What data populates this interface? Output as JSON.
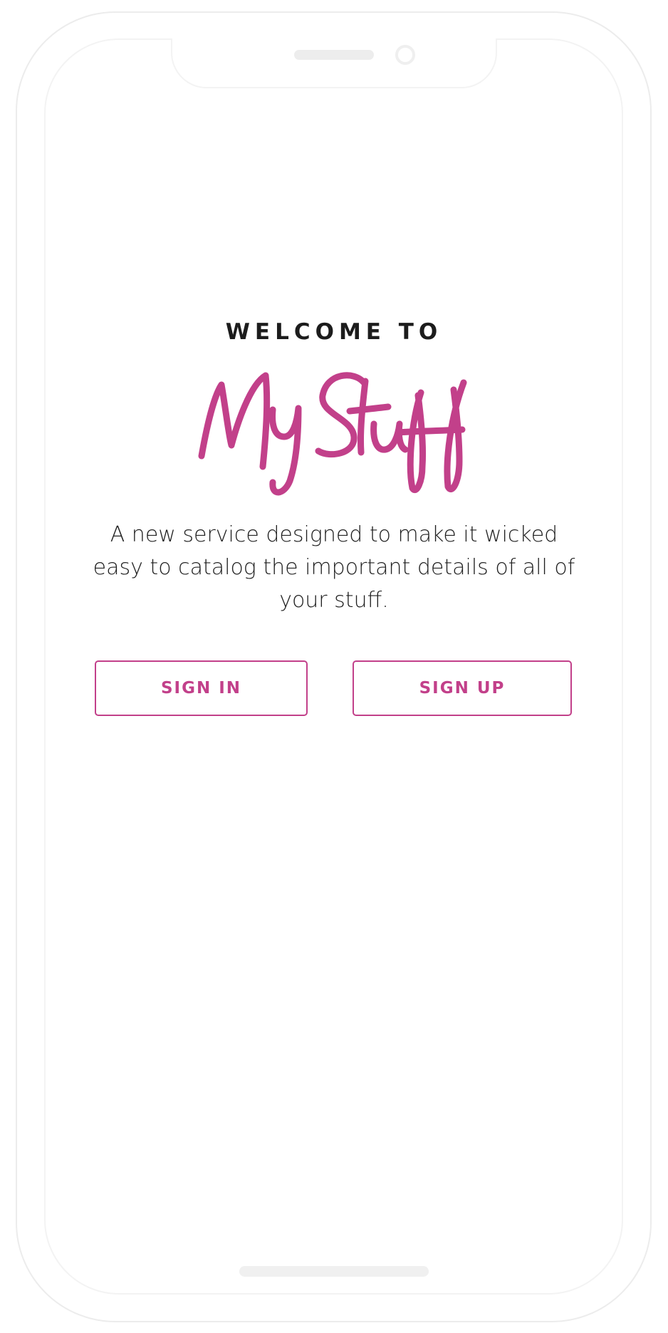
{
  "welcome": {
    "heading": "WELCOME TO",
    "logo_text": "MyStuff",
    "tagline": "A new service designed to make it wicked easy to catalog the important details of all of your stuff."
  },
  "actions": {
    "sign_in_label": "SIGN IN",
    "sign_up_label": "SIGN UP"
  },
  "colors": {
    "accent": "#c2408a",
    "text": "#1c1c1c",
    "device_outline": "#ececec"
  },
  "icons": {
    "speaker": "speaker-grille-icon",
    "camera": "front-camera-icon"
  }
}
